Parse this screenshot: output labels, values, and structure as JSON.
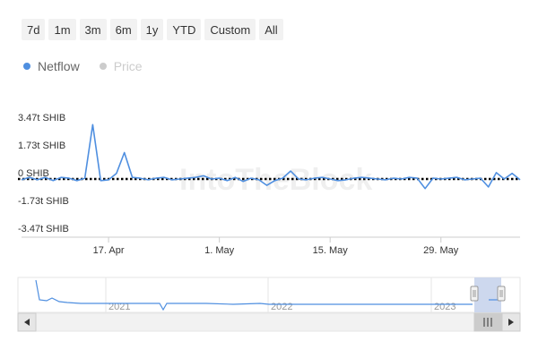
{
  "range_buttons": [
    "7d",
    "1m",
    "3m",
    "6m",
    "1y",
    "YTD",
    "Custom",
    "All"
  ],
  "legend": [
    {
      "label": "Netflow",
      "color": "#4f8fe0",
      "active": true
    },
    {
      "label": "Price",
      "color": "#cccccc",
      "active": false
    }
  ],
  "watermark": "IntoTheBlock",
  "colors": {
    "netflow": "#4f8fe0",
    "zero_line": "#000000",
    "grid": "#e6e6e6",
    "navigator_mask": "#c8d4ec"
  },
  "chart_data": {
    "type": "line",
    "title": "",
    "xlabel": "",
    "ylabel": "",
    "x_range": [
      "2023-04-06",
      "2023-06-08"
    ],
    "y_range": [
      -3.47,
      3.47
    ],
    "y_unit": "t SHIB",
    "y_ticks": [
      {
        "value": 3.47,
        "label": "3.47t SHIB"
      },
      {
        "value": 1.73,
        "label": "1.73t SHIB"
      },
      {
        "value": 0,
        "label": "0 SHIB"
      },
      {
        "value": -1.73,
        "label": "-1.73t SHIB"
      },
      {
        "value": -3.47,
        "label": "-3.47t SHIB"
      }
    ],
    "x_ticks": [
      {
        "date": "2023-04-17",
        "label": "17. Apr"
      },
      {
        "date": "2023-05-01",
        "label": "1. May"
      },
      {
        "date": "2023-05-15",
        "label": "15. May"
      },
      {
        "date": "2023-05-29",
        "label": "29. May"
      }
    ],
    "grid": false,
    "zero_line": "dotted",
    "series": [
      {
        "name": "Netflow",
        "color": "#4f8fe0",
        "x": [
          "2023-04-06",
          "2023-04-07",
          "2023-04-08",
          "2023-04-09",
          "2023-04-10",
          "2023-04-11",
          "2023-04-12",
          "2023-04-13",
          "2023-04-14",
          "2023-04-15",
          "2023-04-16",
          "2023-04-17",
          "2023-04-18",
          "2023-04-19",
          "2023-04-20",
          "2023-04-21",
          "2023-04-22",
          "2023-04-23",
          "2023-04-24",
          "2023-04-25",
          "2023-04-26",
          "2023-04-27",
          "2023-04-28",
          "2023-04-29",
          "2023-04-30",
          "2023-05-01",
          "2023-05-02",
          "2023-05-03",
          "2023-05-04",
          "2023-05-05",
          "2023-05-06",
          "2023-05-07",
          "2023-05-08",
          "2023-05-09",
          "2023-05-10",
          "2023-05-11",
          "2023-05-12",
          "2023-05-13",
          "2023-05-14",
          "2023-05-15",
          "2023-05-16",
          "2023-05-17",
          "2023-05-18",
          "2023-05-19",
          "2023-05-20",
          "2023-05-21",
          "2023-05-22",
          "2023-05-23",
          "2023-05-24",
          "2023-05-25",
          "2023-05-26",
          "2023-05-27",
          "2023-05-28",
          "2023-05-29",
          "2023-05-30",
          "2023-05-31",
          "2023-06-01",
          "2023-06-02",
          "2023-06-03",
          "2023-06-04",
          "2023-06-05",
          "2023-06-06",
          "2023-06-07",
          "2023-06-08"
        ],
        "values": [
          -0.05,
          0.1,
          -0.05,
          0.1,
          -0.1,
          0.1,
          0.05,
          -0.1,
          0.05,
          3.4,
          -0.1,
          -0.05,
          0.35,
          1.65,
          0.1,
          0.05,
          -0.05,
          0.05,
          0.1,
          -0.05,
          0.0,
          0.05,
          0.1,
          0.2,
          0.0,
          0.05,
          -0.1,
          0.1,
          -0.15,
          0.05,
          -0.05,
          -0.4,
          -0.1,
          0.05,
          0.5,
          0.0,
          -0.05,
          0.05,
          0.1,
          0.0,
          -0.1,
          -0.05,
          0.05,
          0.1,
          0.05,
          0.0,
          -0.05,
          0.05,
          0.0,
          0.1,
          0.05,
          -0.6,
          0.05,
          0.0,
          0.05,
          0.1,
          -0.05,
          0.0,
          0.05,
          -0.5,
          0.4,
          0.0,
          0.35,
          -0.05
        ]
      }
    ],
    "navigator": {
      "labels": [
        "2021",
        "2022",
        "2023"
      ],
      "selected_range": [
        "2023-04-06",
        "2023-06-08"
      ],
      "handle_icon": "grip-lines-icon",
      "left_arrow_icon": "arrow-left-icon",
      "right_arrow_icon": "arrow-right-icon"
    }
  }
}
